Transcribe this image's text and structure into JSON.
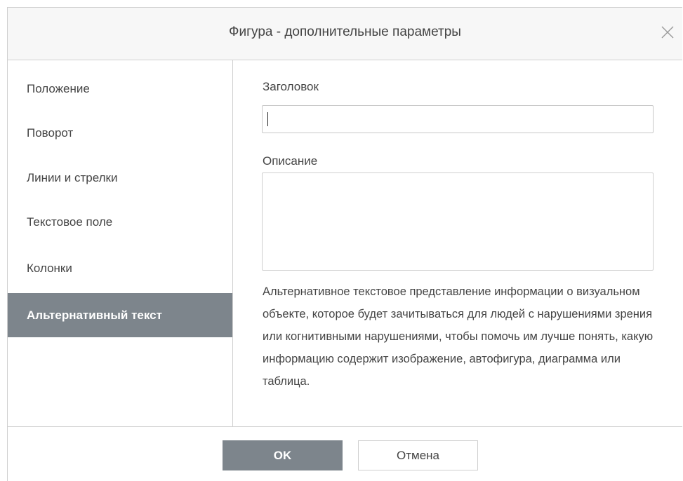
{
  "dialog": {
    "title": "Фигура - дополнительные параметры",
    "close_icon": "close-icon"
  },
  "sidebar": {
    "items": [
      {
        "label": "Положение",
        "active": false
      },
      {
        "label": "Поворот",
        "active": false
      },
      {
        "label": "Линии и стрелки",
        "active": false
      },
      {
        "label": "Текстовое поле",
        "active": false
      },
      {
        "label": "Колонки",
        "active": false
      },
      {
        "label": "Альтернативный текст",
        "active": true
      }
    ]
  },
  "content": {
    "title_label": "Заголовок",
    "title_value": "",
    "description_label": "Описание",
    "description_value": "",
    "help_text": "Альтернативное текстовое представление информации о визуальном объекте, которое будет зачитываться для людей с нарушениями зрения или когнитивными нарушениями, чтобы помочь им лучше понять, какую информацию содержит изображение, автофигура, диаграмма или таблица."
  },
  "footer": {
    "ok_label": "OK",
    "cancel_label": "Отмена"
  },
  "colors": {
    "accent": "#7d858c",
    "text": "#444444",
    "header_bg": "#f7f7f7",
    "border": "#d0d0d0"
  }
}
